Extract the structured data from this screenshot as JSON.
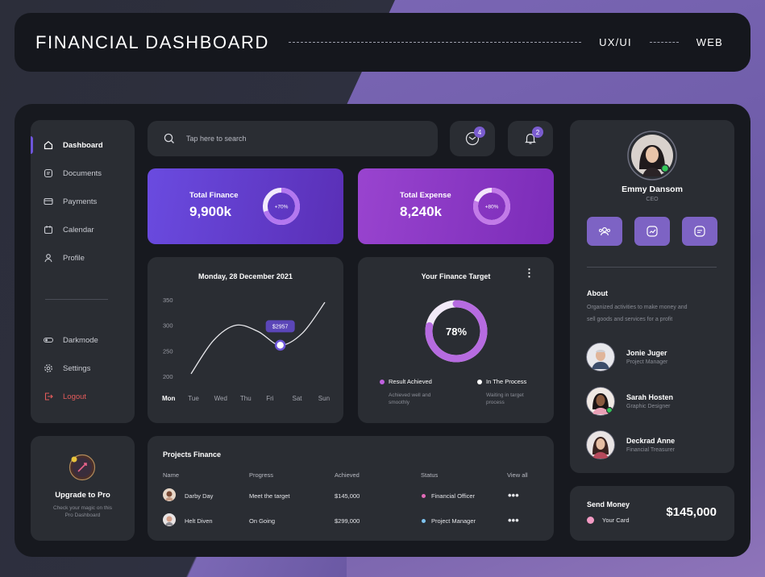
{
  "header": {
    "title": "FINANCIAL DASHBOARD",
    "tag1": "UX/UI",
    "tag2": "WEB"
  },
  "sidebar": {
    "items": [
      {
        "label": "Dashboard",
        "icon": "home-icon"
      },
      {
        "label": "Documents",
        "icon": "document-icon"
      },
      {
        "label": "Payments",
        "icon": "card-icon"
      },
      {
        "label": "Calendar",
        "icon": "calendar-icon"
      },
      {
        "label": "Profile",
        "icon": "user-icon"
      }
    ],
    "bottom": [
      {
        "label": "Darkmode",
        "icon": "toggle-icon"
      },
      {
        "label": "Settings",
        "icon": "gear-icon"
      },
      {
        "label": "Logout",
        "icon": "logout-icon"
      }
    ]
  },
  "upgrade": {
    "title": "Upgrade to Pro",
    "subtitle_line1": "Check your magic on this",
    "subtitle_line2": "Pro Dashboard"
  },
  "search": {
    "placeholder": "Tap here to search"
  },
  "notifications": {
    "mail_count": "4",
    "bell_count": "2"
  },
  "total_finance": {
    "label": "Total Finance",
    "value": "9,900k",
    "percent_label": "+70%",
    "percent": 70
  },
  "total_expense": {
    "label": "Total Expense",
    "value": "8,240k",
    "percent_label": "+80%",
    "percent": 80
  },
  "line_chart": {
    "title": "Monday, 28 December 2021",
    "tooltip": "$2957",
    "yticks": [
      "350",
      "300",
      "250",
      "200"
    ],
    "xticks": [
      "Mon",
      "Tue",
      "Wed",
      "Thu",
      "Fri",
      "Sat",
      "Sun"
    ]
  },
  "chart_data": {
    "type": "line",
    "title": "Monday, 28 December 2021",
    "categories": [
      "Mon",
      "Tue",
      "Wed",
      "Thu",
      "Fri",
      "Sat",
      "Sun"
    ],
    "values": [
      205,
      270,
      300,
      288,
      261,
      285,
      345
    ],
    "ylim": [
      200,
      350
    ],
    "highlight": {
      "category": "Fri",
      "label": "$2957"
    }
  },
  "target": {
    "title": "Your Finance Target",
    "percent_label": "78%",
    "percent": 78,
    "legend": [
      {
        "label": "Result Achieved",
        "desc_line1": "Achieved well and",
        "desc_line2": "smoothly",
        "color": "#c061e0"
      },
      {
        "label": "In The Process",
        "desc_line1": "Waiting in target",
        "desc_line2": "process",
        "color": "#ffffff"
      }
    ]
  },
  "projects": {
    "title": "Projects Finance",
    "headers": [
      "Name",
      "Progress",
      "Achieved",
      "Status",
      "View all"
    ],
    "rows": [
      {
        "name": "Darby Day",
        "progress": "Meet the target",
        "achieved": "$145,000",
        "status": "Financial Officer",
        "status_color": "#e26bb8"
      },
      {
        "name": "Helt Diven",
        "progress": "On Going",
        "achieved": "$299,000",
        "status": "Project Manager",
        "status_color": "#7ec3ef"
      }
    ]
  },
  "profile": {
    "name": "Emmy Dansom",
    "role": "CEO",
    "about_title": "About",
    "about_line1": "Organized activities to make money and",
    "about_line2": "sell goods and services for a profit",
    "people": [
      {
        "name": "Jonie Juger",
        "role": "Project Manager"
      },
      {
        "name": "Sarah Hosten",
        "role": "Graphic Designer"
      },
      {
        "name": "Deckrad Anne",
        "role": "Financial Treasurer"
      }
    ]
  },
  "send_money": {
    "title": "Send Money",
    "card_label": "Your Card",
    "amount": "$145,000"
  }
}
